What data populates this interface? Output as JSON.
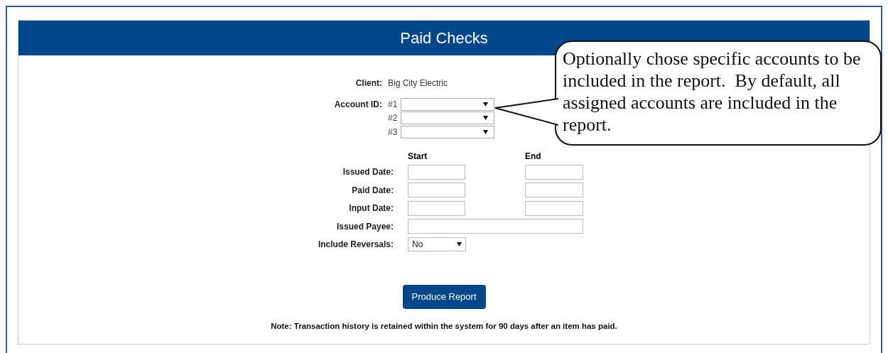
{
  "header": {
    "title": "Paid Checks"
  },
  "client": {
    "label": "Client:",
    "value": "Big City Electric"
  },
  "account_id": {
    "label": "Account ID:",
    "selects": [
      {
        "label": "#1"
      },
      {
        "label": "#2"
      },
      {
        "label": "#3"
      }
    ]
  },
  "date_columns": [
    "Start",
    "End"
  ],
  "date_rows": [
    {
      "label": "Issued Date:"
    },
    {
      "label": "Paid Date:"
    },
    {
      "label": "Input Date:"
    }
  ],
  "issued_payee": {
    "label": "Issued Payee:"
  },
  "include_reversals": {
    "label": "Include Reversals:",
    "value": "No"
  },
  "button": "Produce Report",
  "note": "Note: Transaction history is retained within the system for 90 days after an item has paid.",
  "callout": "Optionally chose specific accounts to be included in the report.  By default, all assigned accounts are included in the report."
}
